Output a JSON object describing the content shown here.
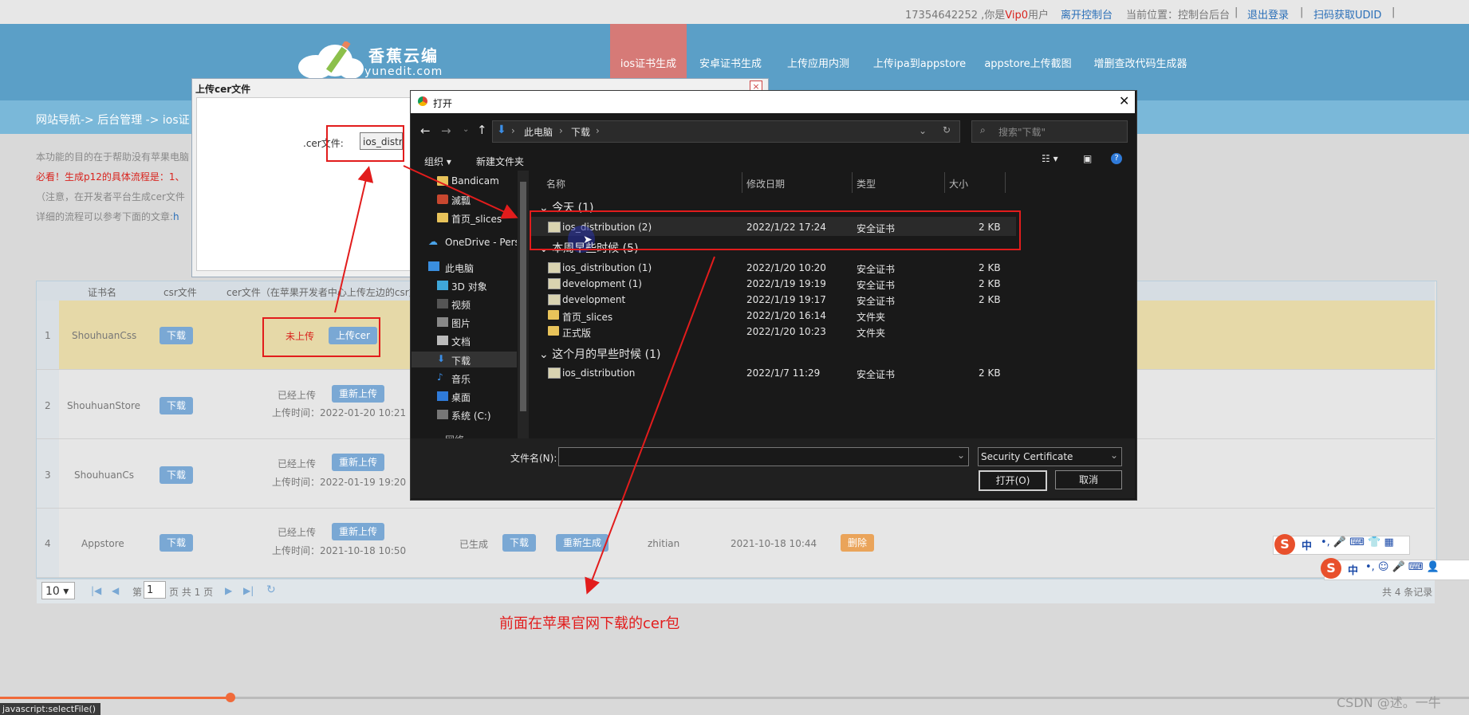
{
  "topbar": {
    "phone_prefix": "17354642252 ,你是",
    "vip": "Vip0",
    "phone_suffix": "用户",
    "leave_console": "离开控制台",
    "current_location": "当前位置：控制台后台",
    "sep1": "|",
    "logout": "退出登录",
    "sep2": "|",
    "get_udid": "扫码获取UDID",
    "sep3": "|"
  },
  "logo": {
    "title": "香蕉云编",
    "subtitle": "yunedit.com"
  },
  "nav": [
    "ios证书生成",
    "安卓证书生成",
    "上传应用内测",
    "上传ipa到appstore",
    "appstore上传截图",
    "增删查改代码生成器"
  ],
  "breadcrumb": "网站导航-> 后台管理 -> ios证",
  "intro": {
    "line1": "本功能的目的在于帮助没有苹果电脑",
    "line2": "必看！生成p12的具体流程是：1、",
    "line3": "（注意，在开发者平台生成cer文件",
    "line4": "详细的流程可以参考下面的文章:",
    "line4_link": "h"
  },
  "table": {
    "headers": [
      "证书名",
      "csr文件",
      "cer文件（在苹果开发者中心上传左边的csr文"
    ],
    "rows": [
      {
        "index": "1",
        "name": "ShouhuanCss",
        "download": "下载",
        "status": "未上传",
        "upload": "上传cer",
        "time": ""
      },
      {
        "index": "2",
        "name": "ShouhuanStore",
        "download": "下载",
        "status": "已经上传",
        "upload": "重新上传",
        "time": "上传时间：2022-01-20 10:21"
      },
      {
        "index": "3",
        "name": "ShouhuanCs",
        "download": "下载",
        "status": "已经上传",
        "upload": "重新上传",
        "time": "上传时间：2022-01-19 19:20"
      },
      {
        "index": "4",
        "name": "Appstore",
        "download": "下载",
        "status": "已经上传",
        "upload": "重新上传",
        "time": "上传时间：2021-10-18 10:50",
        "generated": "已生成",
        "dl2": "下载",
        "regen": "重新生成",
        "user": "zhitian",
        "created": "2021-10-18 10:44",
        "delete": "删除"
      }
    ]
  },
  "pager": {
    "page_size": "10",
    "page_prefix": "第",
    "page_value": "1",
    "page_suffix": "页 共 1 页",
    "total": "共 4 条记录"
  },
  "upload_dialog": {
    "title": "上传cer文件",
    "cer_label": ".cer文件:",
    "cer_value": "ios_distrib"
  },
  "open_dialog": {
    "title": "打开",
    "path": [
      "此电脑",
      "下载"
    ],
    "search_placeholder": "搜索\"下载\"",
    "organize": "组织 ▾",
    "new_folder": "新建文件夹",
    "columns": [
      "名称",
      "修改日期",
      "类型",
      "大小"
    ],
    "sidebar": [
      "Bandicam",
      "滅瓢",
      "首页_slices",
      "OneDrive - Perso",
      "此电脑",
      "3D 对象",
      "视频",
      "图片",
      "文档",
      "下载",
      "音乐",
      "桌面",
      "系统 (C:)",
      "网络"
    ],
    "groups": {
      "today": "今天 (1)",
      "this_week": "本周早些时候 (5)",
      "this_month": "这个月的早些时候 (1)"
    },
    "files": [
      {
        "name": "ios_distribution (2)",
        "date": "2022/1/22 17:24",
        "type": "安全证书",
        "size": "2 KB",
        "kind": "cert"
      },
      {
        "name": "ios_distribution (1)",
        "date": "2022/1/20 10:20",
        "type": "安全证书",
        "size": "2 KB",
        "kind": "cert"
      },
      {
        "name": "development (1)",
        "date": "2022/1/19 19:19",
        "type": "安全证书",
        "size": "2 KB",
        "kind": "cert"
      },
      {
        "name": "development",
        "date": "2022/1/19 19:17",
        "type": "安全证书",
        "size": "2 KB",
        "kind": "cert"
      },
      {
        "name": "首页_slices",
        "date": "2022/1/20 16:14",
        "type": "文件夹",
        "size": "",
        "kind": "folder"
      },
      {
        "name": "正式版",
        "date": "2022/1/20 10:23",
        "type": "文件夹",
        "size": "",
        "kind": "folder"
      },
      {
        "name": "ios_distribution",
        "date": "2022/1/7 11:29",
        "type": "安全证书",
        "size": "2 KB",
        "kind": "cert"
      }
    ],
    "filename_label": "文件名(N):",
    "filename_value": "",
    "filetype": "Security Certificate",
    "open_button": "打开(O)",
    "cancel_button": "取消"
  },
  "annotation_text": "前面在苹果官网下载的cer包",
  "ime": {
    "label1": "中",
    "label2": "中"
  },
  "status_url": "javascript:selectFile()",
  "watermark": "CSDN @述。一牛",
  "colors": {
    "header_blue": "#5b9fc7",
    "nav_active": "#d67a77",
    "annotation_red": "#e21c1c"
  }
}
